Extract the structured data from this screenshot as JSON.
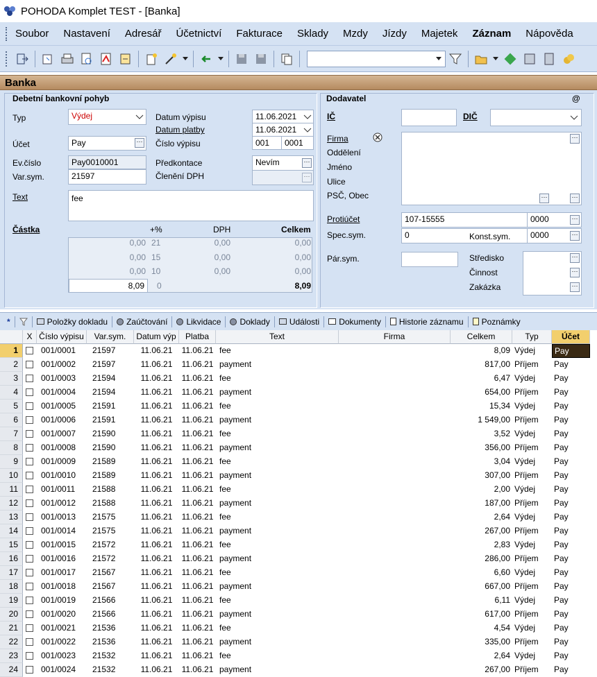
{
  "window": {
    "title": "POHODA Komplet TEST - [Banka]"
  },
  "menu": [
    "Soubor",
    "Nastavení",
    "Adresář",
    "Účetnictví",
    "Fakturace",
    "Sklady",
    "Mzdy",
    "Jízdy",
    "Majetek",
    "Záznam",
    "Nápověda"
  ],
  "form_title": "Banka",
  "left": {
    "section": "Debetní bankovní pohyb",
    "typ_label": "Typ",
    "typ_value": "Výdej",
    "ucet_label": "Účet",
    "ucet_value": "Pay",
    "evcislo_label": "Ev.číslo",
    "evcislo_value": "Pay0010001",
    "varsym_label": "Var.sym.",
    "varsym_value": "21597",
    "text_label": "Text",
    "text_value": "fee",
    "datum_vypisu_label": "Datum výpisu",
    "datum_vypisu": "11.06.2021",
    "datum_platby_label": "Datum platby",
    "datum_platby": "11.06.2021",
    "cislo_vypisu_label": "Číslo výpisu",
    "cislo_vypisu_a": "001",
    "cislo_vypisu_b": "0001",
    "predkontace_label": "Předkontace",
    "predkontace_value": "Nevím",
    "cleneni_label": "Členění DPH",
    "castka_label": "Částka",
    "col_pct": "+%",
    "col_dph": "DPH",
    "col_celkem": "Celkem",
    "sum_rows": [
      {
        "base": "0,00",
        "pct": "21",
        "dph": "0,00",
        "total": "0,00"
      },
      {
        "base": "0,00",
        "pct": "15",
        "dph": "0,00",
        "total": "0,00"
      },
      {
        "base": "0,00",
        "pct": "10",
        "dph": "0,00",
        "total": "0,00"
      },
      {
        "base": "8,09",
        "pct": "0",
        "dph": "",
        "total": "8,09"
      }
    ]
  },
  "right": {
    "section": "Dodavatel",
    "at": "@",
    "ic_label": "IČ",
    "dic_label": "DIČ",
    "firma_label": "Firma",
    "oddeleni_label": "Oddělení",
    "jmeno_label": "Jméno",
    "ulice_label": "Ulice",
    "psc_label": "PSČ, Obec",
    "protiucet_label": "Protiúčet",
    "protiucet_value": "107-15555",
    "bank_code": "0000",
    "specsym_label": "Spec.sym.",
    "specsym_value": "0",
    "konstsym_label": "Konst.sym.",
    "konstsym_value": "0000",
    "parsym_label": "Pár.sym.",
    "stredisko_label": "Středisko",
    "cinnost_label": "Činnost",
    "zakazka_label": "Zakázka"
  },
  "tabs": [
    "Položky dokladu",
    "Zaúčtování",
    "Likvidace",
    "Doklady",
    "Události",
    "Dokumenty",
    "Historie záznamu",
    "Poznámky"
  ],
  "tabs_star": "*",
  "table": {
    "headers": [
      "X",
      "Číslo výpisu",
      "Var.sym.",
      "Datum výp",
      "Platba",
      "Text",
      "Firma",
      "Celkem",
      "Typ",
      "Účet"
    ],
    "rows": [
      [
        "1",
        "001/0001",
        "21597",
        "11.06.21",
        "11.06.21",
        "fee",
        "",
        "8,09",
        "Výdej",
        "Pay"
      ],
      [
        "2",
        "001/0002",
        "21597",
        "11.06.21",
        "11.06.21",
        "payment",
        "",
        "817,00",
        "Příjem",
        "Pay"
      ],
      [
        "3",
        "001/0003",
        "21594",
        "11.06.21",
        "11.06.21",
        "fee",
        "",
        "6,47",
        "Výdej",
        "Pay"
      ],
      [
        "4",
        "001/0004",
        "21594",
        "11.06.21",
        "11.06.21",
        "payment",
        "",
        "654,00",
        "Příjem",
        "Pay"
      ],
      [
        "5",
        "001/0005",
        "21591",
        "11.06.21",
        "11.06.21",
        "fee",
        "",
        "15,34",
        "Výdej",
        "Pay"
      ],
      [
        "6",
        "001/0006",
        "21591",
        "11.06.21",
        "11.06.21",
        "payment",
        "",
        "1 549,00",
        "Příjem",
        "Pay"
      ],
      [
        "7",
        "001/0007",
        "21590",
        "11.06.21",
        "11.06.21",
        "fee",
        "",
        "3,52",
        "Výdej",
        "Pay"
      ],
      [
        "8",
        "001/0008",
        "21590",
        "11.06.21",
        "11.06.21",
        "payment",
        "",
        "356,00",
        "Příjem",
        "Pay"
      ],
      [
        "9",
        "001/0009",
        "21589",
        "11.06.21",
        "11.06.21",
        "fee",
        "",
        "3,04",
        "Výdej",
        "Pay"
      ],
      [
        "10",
        "001/0010",
        "21589",
        "11.06.21",
        "11.06.21",
        "payment",
        "",
        "307,00",
        "Příjem",
        "Pay"
      ],
      [
        "11",
        "001/0011",
        "21588",
        "11.06.21",
        "11.06.21",
        "fee",
        "",
        "2,00",
        "Výdej",
        "Pay"
      ],
      [
        "12",
        "001/0012",
        "21588",
        "11.06.21",
        "11.06.21",
        "payment",
        "",
        "187,00",
        "Příjem",
        "Pay"
      ],
      [
        "13",
        "001/0013",
        "21575",
        "11.06.21",
        "11.06.21",
        "fee",
        "",
        "2,64",
        "Výdej",
        "Pay"
      ],
      [
        "14",
        "001/0014",
        "21575",
        "11.06.21",
        "11.06.21",
        "payment",
        "",
        "267,00",
        "Příjem",
        "Pay"
      ],
      [
        "15",
        "001/0015",
        "21572",
        "11.06.21",
        "11.06.21",
        "fee",
        "",
        "2,83",
        "Výdej",
        "Pay"
      ],
      [
        "16",
        "001/0016",
        "21572",
        "11.06.21",
        "11.06.21",
        "payment",
        "",
        "286,00",
        "Příjem",
        "Pay"
      ],
      [
        "17",
        "001/0017",
        "21567",
        "11.06.21",
        "11.06.21",
        "fee",
        "",
        "6,60",
        "Výdej",
        "Pay"
      ],
      [
        "18",
        "001/0018",
        "21567",
        "11.06.21",
        "11.06.21",
        "payment",
        "",
        "667,00",
        "Příjem",
        "Pay"
      ],
      [
        "19",
        "001/0019",
        "21566",
        "11.06.21",
        "11.06.21",
        "fee",
        "",
        "6,11",
        "Výdej",
        "Pay"
      ],
      [
        "20",
        "001/0020",
        "21566",
        "11.06.21",
        "11.06.21",
        "payment",
        "",
        "617,00",
        "Příjem",
        "Pay"
      ],
      [
        "21",
        "001/0021",
        "21536",
        "11.06.21",
        "11.06.21",
        "fee",
        "",
        "4,54",
        "Výdej",
        "Pay"
      ],
      [
        "22",
        "001/0022",
        "21536",
        "11.06.21",
        "11.06.21",
        "payment",
        "",
        "335,00",
        "Příjem",
        "Pay"
      ],
      [
        "23",
        "001/0023",
        "21532",
        "11.06.21",
        "11.06.21",
        "fee",
        "",
        "2,64",
        "Výdej",
        "Pay"
      ],
      [
        "24",
        "001/0024",
        "21532",
        "11.06.21",
        "11.06.21",
        "payment",
        "",
        "267,00",
        "Příjem",
        "Pay"
      ]
    ]
  },
  "colors": {
    "accent": "#f2cf6d",
    "selected_cell": "#3a2a14",
    "form_bg": "#d5e2f3",
    "header_brown": "#b58b60",
    "typ_red": "#cc0000"
  }
}
